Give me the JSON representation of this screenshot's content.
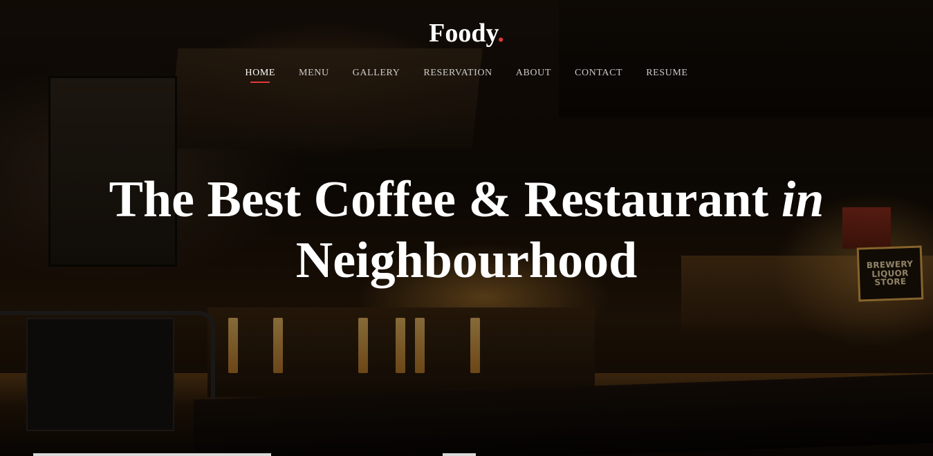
{
  "header": {
    "logo_text": "Foody",
    "logo_dot": ".",
    "accent_color": "#e03a3a"
  },
  "nav": {
    "items": [
      {
        "label": "HOME",
        "active": true
      },
      {
        "label": "MENU",
        "active": false
      },
      {
        "label": "GALLERY",
        "active": false
      },
      {
        "label": "RESERVATION",
        "active": false
      },
      {
        "label": "ABOUT",
        "active": false
      },
      {
        "label": "CONTACT",
        "active": false
      },
      {
        "label": "RESUME",
        "active": false
      }
    ]
  },
  "hero": {
    "headline_line1": "The Best Coffee & Restaurant",
    "headline_em": "in",
    "headline_line2": "Neighbourhood",
    "background": "restaurant-bar-interior-photo",
    "sign_text": "BREWERY LIQUOR STORE"
  }
}
